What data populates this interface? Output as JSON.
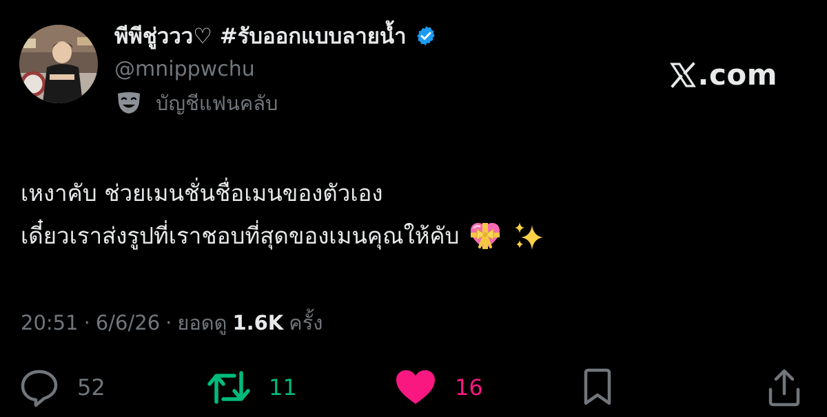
{
  "author": {
    "display_name": "พีพีชู่ววว♡ #รับออกแบบลายน้ำ",
    "handle": "@mnippwchu",
    "account_label": "บัญชีแฟนคลับ",
    "verified": true,
    "avatar_icon": "profile-photo"
  },
  "brand": {
    "text": ".com",
    "logo_icon": "x-logo-icon"
  },
  "tweet": {
    "lines": [
      "เหงาคับ ช่วยเมนชั่นชื่อเมนของตัวเอง",
      "เดี๋ยวเราส่งรูปที่เราชอบที่สุดของเมนคุณให้คับ"
    ],
    "emojis": [
      "heart-with-ribbon",
      "sparkles"
    ]
  },
  "meta": {
    "time": "20:51",
    "separator": "·",
    "date": "6/6/26",
    "views_label": "ยอดดู",
    "views_count": "1.6K",
    "views_suffix": "ครั้ง"
  },
  "actions": {
    "replies": "52",
    "reposts": "11",
    "likes": "16"
  },
  "colors": {
    "background": "#000000",
    "text_primary": "#e7e9ea",
    "text_secondary": "#71767b",
    "verified_blue": "#1d9bf0",
    "repost_green": "#00ba7c",
    "like_pink": "#f91880"
  }
}
